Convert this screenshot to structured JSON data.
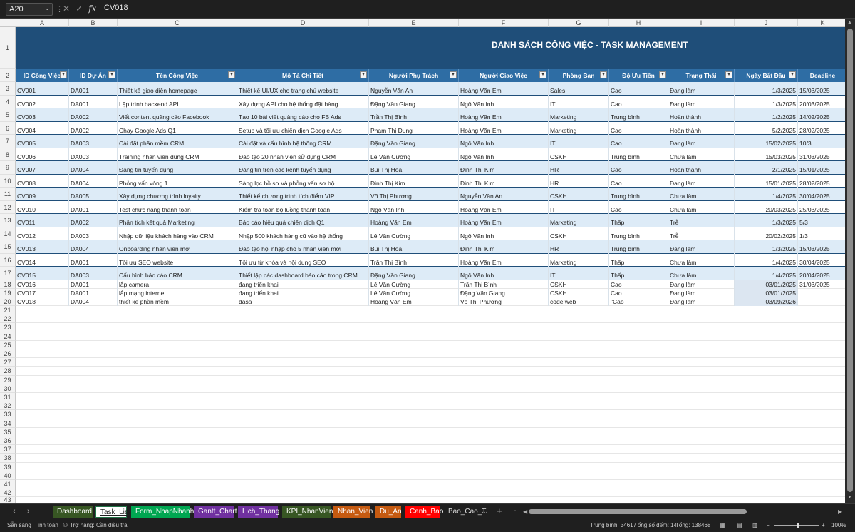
{
  "formula_bar": {
    "name_box": "A20",
    "value": "CV018"
  },
  "sheet": {
    "columns": [
      "A",
      "B",
      "C",
      "D",
      "E",
      "F",
      "G",
      "H",
      "I",
      "J",
      "K"
    ],
    "title": "DANH SÁCH CÔNG VIỆC - TASK MANAGEMENT",
    "headers": [
      "ID Công Việc",
      "ID Dự Án",
      "Tên Công Việc",
      "Mô Tả Chi Tiết",
      "Người Phụ Trách",
      "Người Giao Việc",
      "Phòng Ban",
      "Độ Ưu Tiên",
      "Trạng Thái",
      "Ngày Bắt Đầu",
      "Deadline"
    ],
    "row_numbers": [
      "1",
      "2",
      "3",
      "4",
      "5",
      "6",
      "7",
      "8",
      "9",
      "10",
      "11",
      "12",
      "13",
      "14",
      "15",
      "16",
      "17",
      "18",
      "19",
      "20",
      "21",
      "22",
      "23",
      "24",
      "25",
      "26",
      "27",
      "28",
      "29",
      "30",
      "31",
      "32",
      "33",
      "34",
      "35",
      "36",
      "37",
      "38",
      "39",
      "40",
      "41",
      "42",
      "43",
      "44"
    ],
    "rows": [
      [
        "CV001",
        "DA001",
        "Thiết kế giao diện homepage",
        "Thiết kế UI/UX cho trang chủ website",
        "Nguyễn Văn An",
        "Hoàng Văn Em",
        "Sales",
        "Cao",
        "Đang làm",
        "1/3/2025",
        "15/03/2025"
      ],
      [
        "CV002",
        "DA001",
        "Lập trình backend API",
        "Xây dựng API cho hệ thống đặt hàng",
        "Đặng Văn Giang",
        "Ngô Văn Inh",
        "IT",
        "Cao",
        "Đang làm",
        "1/3/2025",
        "20/03/2025"
      ],
      [
        "CV003",
        "DA002",
        "Viết content quảng cáo Facebook",
        "Tạo 10 bài viết quảng cáo cho FB Ads",
        "Trần Thị Bình",
        "Hoàng Văn Em",
        "Marketing",
        "Trung bình",
        "Hoàn thành",
        "1/2/2025",
        "14/02/2025"
      ],
      [
        "CV004",
        "DA002",
        "Chạy Google Ads Q1",
        "Setup và tối ưu chiến dịch Google Ads",
        "Phạm Thị Dung",
        "Hoàng Văn Em",
        "Marketing",
        "Cao",
        "Hoàn thành",
        "5/2/2025",
        "28/02/2025"
      ],
      [
        "CV005",
        "DA003",
        "Cài đặt phần mềm CRM",
        "Cài đặt và cấu hình hệ thống CRM",
        "Đặng Văn Giang",
        "Ngô Văn Inh",
        "IT",
        "Cao",
        "Đang làm",
        "15/02/2025",
        "10/3"
      ],
      [
        "CV006",
        "DA003",
        "Training nhân viên dùng CRM",
        "Đào tạo 20 nhân viên sử dụng CRM",
        "Lê Văn Cường",
        "Ngô Văn Inh",
        "CSKH",
        "Trung bình",
        "Chưa làm",
        "15/03/2025",
        "31/03/2025"
      ],
      [
        "CV007",
        "DA004",
        "Đăng tin tuyển dụng",
        "Đăng tin trên các kênh tuyển dụng",
        "Bùi Thị Hoa",
        "Đinh Thị Kim",
        "HR",
        "Cao",
        "Hoàn thành",
        "2/1/2025",
        "15/01/2025"
      ],
      [
        "CV008",
        "DA004",
        "Phỏng vấn vòng 1",
        "Sàng lọc hồ sơ và phỏng vấn sơ bộ",
        "Đinh Thị Kim",
        "Đinh Thị Kim",
        "HR",
        "Cao",
        "Đang làm",
        "15/01/2025",
        "28/02/2025"
      ],
      [
        "CV009",
        "DA005",
        "Xây dựng chương trình loyalty",
        "Thiết kế chương trình tích điểm VIP",
        "Võ Thị Phương",
        "Nguyễn Văn An",
        "CSKH",
        "Trung bình",
        "Chưa làm",
        "1/4/2025",
        "30/04/2025"
      ],
      [
        "CV010",
        "DA001",
        "Test chức năng thanh toán",
        "Kiểm tra toàn bộ luồng thanh toán",
        "Ngô Văn Inh",
        "Hoàng Văn Em",
        "IT",
        "Cao",
        "Chưa làm",
        "20/03/2025",
        "25/03/2025"
      ],
      [
        "CV011",
        "DA002",
        "Phân tích kết quả Marketing",
        "Báo cáo hiệu quả chiến dịch Q1",
        "Hoàng Văn Em",
        "Hoàng Văn Em",
        "Marketing",
        "Thấp",
        "Trễ",
        "1/3/2025",
        "5/3"
      ],
      [
        "CV012",
        "DA003",
        "Nhập dữ liệu khách hàng vào CRM",
        "Nhập 500 khách hàng cũ vào hệ thống",
        "Lê Văn Cường",
        "Ngô Văn Inh",
        "CSKH",
        "Trung bình",
        "Trễ",
        "20/02/2025",
        "1/3"
      ],
      [
        "CV013",
        "DA004",
        "Onboarding nhân viên mới",
        "Đào tạo hội nhập cho 5 nhân viên mới",
        "Bùi Thị Hoa",
        "Đinh Thị Kim",
        "HR",
        "Trung bình",
        "Đang làm",
        "1/3/2025",
        "15/03/2025"
      ],
      [
        "CV014",
        "DA001",
        "Tối ưu SEO website",
        "Tối ưu từ khóa và nội dung SEO",
        "Trần Thị Bình",
        "Hoàng Văn Em",
        "Marketing",
        "Thấp",
        "Chưa làm",
        "1/4/2025",
        "30/04/2025"
      ],
      [
        "CV015",
        "DA003",
        "Cấu hình báo cáo CRM",
        "Thiết lập các dashboard báo cáo trong CRM",
        "Đặng Văn Giang",
        "Ngô Văn Inh",
        "IT",
        "Thấp",
        "Chưa làm",
        "1/4/2025",
        "20/04/2025"
      ],
      [
        "CV016",
        "DA001",
        "lắp camera",
        "đang triển khai",
        "Lê Văn Cường",
        "Trần Thị Bình",
        "CSKH",
        "Cao",
        "Đang làm",
        "03/01/2025",
        "31/03/2025"
      ],
      [
        "CV017",
        "DA001",
        "lắp mạng internet",
        "đang triển khai",
        "Lê Văn Cường",
        "Đặng Văn Giang",
        "CSKH",
        "Cao",
        "Đang làm",
        "03/01/2025",
        ""
      ],
      [
        "CV018",
        "DA004",
        "thiết kế phần mềm",
        "đasa",
        "Hoàng Văn Em",
        "Võ Thị Phương",
        "code web",
        "\"Cao",
        "Đang làm",
        "03/09/2026",
        ""
      ]
    ]
  },
  "tabs": [
    {
      "label": "Dashboard",
      "color": "#375623"
    },
    {
      "label": "Task_List",
      "color": "#ffffff"
    },
    {
      "label": "Form_NhapNhanh",
      "color": "#00a651"
    },
    {
      "label": "Gantt_Chart",
      "color": "#7030a0"
    },
    {
      "label": "Lich_Thang",
      "color": "#7030a0"
    },
    {
      "label": "KPI_NhanVien",
      "color": "#375623"
    },
    {
      "label": "Nhan_Vien",
      "color": "#c55a11"
    },
    {
      "label": "Du_An",
      "color": "#c55a11"
    },
    {
      "label": "Canh_Bao",
      "color": "#ff0000"
    },
    {
      "label": "Bao_Cao_T",
      "color": "#1f1f1f"
    }
  ],
  "tab_more": "...",
  "tab_add": "+",
  "status": {
    "ready": "Sẵn sàng",
    "calc": "Tính toán",
    "accessibility": "Trợ năng: Cần điều tra",
    "average": "Trung bình: 34617",
    "count": "Tổng số đếm: 14",
    "sum": "Tổng: 138468",
    "zoom": "100%"
  }
}
